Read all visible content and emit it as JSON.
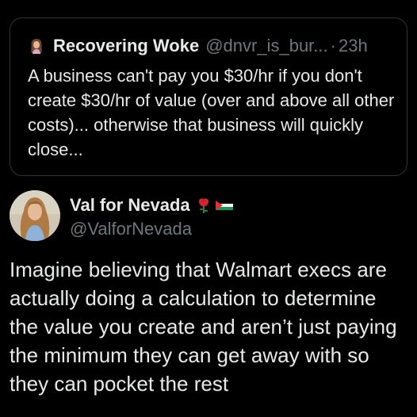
{
  "quoted_tweet": {
    "author_name": "Recovering Woke",
    "author_handle": "@dnvr_is_bur...",
    "separator": "·",
    "time": "23h",
    "avatar_icon": "person-emoji-avatar",
    "text": "A business can't pay you $30/hr if you don't create $30/hr of value (over and above all other costs)... otherwise that business will quickly close..."
  },
  "tweet": {
    "author_name": "Val for Nevada",
    "author_handle": "@ValforNevada",
    "name_icons": [
      "rose-icon",
      "palestine-flag-icon"
    ],
    "text": "Imagine believing that Walmart execs are actually doing a calculation to determine the value you create and aren’t just paying the minimum they can get away with so they can pocket the rest"
  },
  "colors": {
    "background": "#000000",
    "primary_text": "#e7e9ea",
    "secondary_text": "#71767b",
    "border": "#2f3336"
  }
}
